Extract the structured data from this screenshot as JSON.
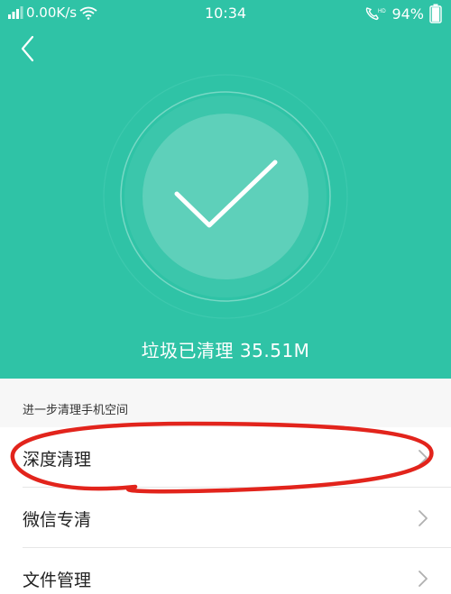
{
  "status_bar": {
    "network_speed": "0.00K/s",
    "time": "10:34",
    "battery": "94%",
    "icons": [
      "signal-icon",
      "wifi-icon",
      "hd-call-icon",
      "battery-icon"
    ]
  },
  "nav": {
    "back_icon": "chevron-left-icon"
  },
  "hero": {
    "status_icon": "checkmark-icon",
    "result_text": "垃圾已清理 35.51M"
  },
  "section": {
    "title": "进一步清理手机空间"
  },
  "list": {
    "items": [
      {
        "label": "深度清理",
        "icon": "chevron-right-icon"
      },
      {
        "label": "微信专清",
        "icon": "chevron-right-icon"
      },
      {
        "label": "文件管理",
        "icon": "chevron-right-icon"
      }
    ]
  },
  "colors": {
    "hero_bg": "#2fc3a6",
    "annotation_ring": "#e2241c"
  }
}
